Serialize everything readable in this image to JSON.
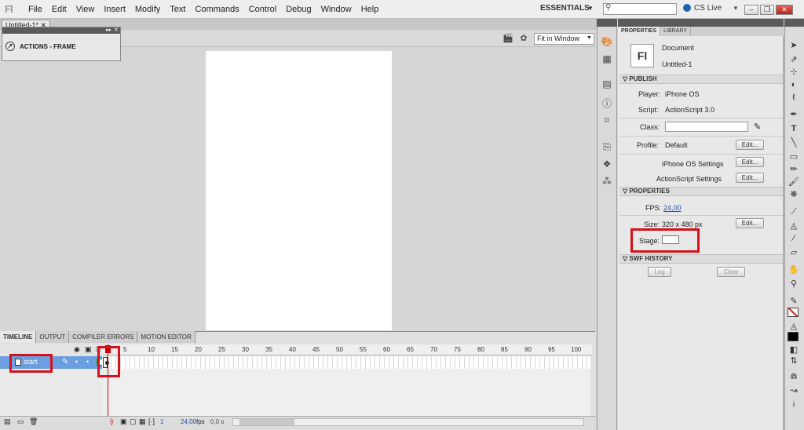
{
  "app": {
    "logo": "Fl",
    "menus": [
      "File",
      "Edit",
      "View",
      "Insert",
      "Modify",
      "Text",
      "Commands",
      "Control",
      "Debug",
      "Window",
      "Help"
    ],
    "workspace": "ESSENTIALS",
    "cslive": "CS Live"
  },
  "document": {
    "tab": "Untitled-1*",
    "zoom": "Fit in Window"
  },
  "actions_panel": {
    "title": "ACTIONS - FRAME"
  },
  "timeline": {
    "tabs": [
      "TIMELINE",
      "OUTPUT",
      "COMPILER ERRORS",
      "MOTION EDITOR"
    ],
    "ticks": [
      "1",
      "5",
      "10",
      "15",
      "20",
      "25",
      "30",
      "35",
      "40",
      "45",
      "50",
      "55",
      "60",
      "65",
      "70",
      "75",
      "80",
      "85",
      "90",
      "95",
      "100"
    ],
    "layer": "start",
    "frame": "1",
    "fps": "24,00",
    "fps_unit": "fps",
    "time": "0,0 s"
  },
  "properties": {
    "tabs": [
      "PROPERTIES",
      "LIBRARY"
    ],
    "doc_icon": "Fl",
    "doc_type": "Document",
    "doc_name": "Untitled-1",
    "publish": {
      "header": "PUBLISH",
      "player_label": "Player:",
      "player": "iPhone OS",
      "script_label": "Script:",
      "script": "ActionScript 3.0",
      "class_label": "Class:",
      "profile_label": "Profile:",
      "profile": "Default",
      "edit": "Edit...",
      "iphone_settings": "iPhone OS Settings",
      "as_settings": "ActionScript Settings"
    },
    "props": {
      "header": "PROPERTIES",
      "fps_label": "FPS:",
      "fps": "24,00",
      "size_label": "Size:",
      "size": "320 x 480 px",
      "stage_label": "Stage:",
      "edit": "Edit..."
    },
    "swf": {
      "header": "SWF HISTORY",
      "log": "Log",
      "clear": "Clear"
    }
  },
  "colors": {
    "highlight": "#d6111b",
    "layer": "#6b9fe0",
    "link": "#1d4fb8"
  }
}
